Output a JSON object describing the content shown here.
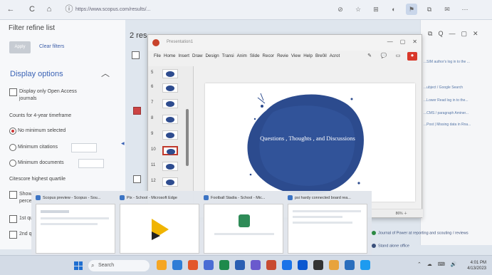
{
  "browser": {
    "url": "https://www.scopus.com/results/...",
    "nav": [
      "←",
      "C",
      "⌂"
    ],
    "extensions": [
      "⊘",
      "☆",
      "⊞",
      "◐",
      "⚑",
      "⧉",
      "✉",
      "⋯"
    ]
  },
  "left_panel": {
    "title": "Filter refine list",
    "apply_label": "Apply",
    "clear_label": "Clear filters",
    "display_options": "Display options",
    "collapse_glyph": "︿",
    "open_access_line1": "Display only Open Access",
    "open_access_line2": "journals",
    "counts_heading": "Counts for 4-year timeframe",
    "no_minimum": "No minimum selected",
    "min_citations": "Minimum citations",
    "min_documents": "Minimum documents",
    "quartile_heading": "Citescore highest quartile",
    "show_line1": "Show",
    "show_line2": "perce",
    "first_q": "1st qu",
    "second_q": "2nd q"
  },
  "results": {
    "count": "2 res"
  },
  "right_window": {
    "toolbar": [
      "⧉",
      "Q",
      "—",
      "▢",
      "✕"
    ],
    "lines": [
      "...SIM author's log in to the ...",
      "...ubject / Google Search",
      "...Lower Read log in to the...",
      "...CMS / paragraph Aminer...",
      "...Post | Missing data in Rna..."
    ]
  },
  "ppt": {
    "title": "Presentation1",
    "menu": [
      "File",
      "Home",
      "Insert",
      "Draw",
      "Design",
      "Transi",
      "Anim",
      "Slide",
      "Recor",
      "Revie",
      "View",
      "Help",
      "Bre0il",
      "Acrot"
    ],
    "tools": [
      "✎",
      "💬",
      "▭",
      "⏺"
    ],
    "window_buttons": [
      "—",
      "▢",
      "✕"
    ],
    "thumbs": [
      "5",
      "6",
      "7",
      "8",
      "9",
      "10",
      "11",
      "12"
    ],
    "selected_thumb": "10",
    "slide_text": "Questions , Thoughts , and Discussions",
    "zoom": "86% ＋"
  },
  "previews": [
    {
      "label": "Scopus preview - Scopus - Sou...",
      "color": "#2b6cc4"
    },
    {
      "label": "Pix - School - Microsoft Edge",
      "color": "#f0b400"
    },
    {
      "label": "Football Stadia - School - Mic...",
      "color": "#2e8b57"
    },
    {
      "label": "psi hardy connected board rea...",
      "color": "#1b5fb5"
    }
  ],
  "side_links": [
    "Journal of Power at reporting and scouting / reviews",
    "Stand alone office"
  ],
  "taskbar": {
    "search": "Search",
    "tray_time": "4:01 PM",
    "tray_date": "4/13/2023",
    "tray_icons": "⌃ ☁ ⌨ 🔊",
    "icon_colors": [
      "#f5a623",
      "#2f7dd6",
      "#e3572a",
      "#4a6cd4",
      "#1e8a4c",
      "#2b5fb3",
      "#6a5acd",
      "#c84b31",
      "#1a73e8",
      "#0b57d0",
      "#333333",
      "#e8a33d",
      "#2a6ebd",
      "#1d9bf0"
    ]
  }
}
